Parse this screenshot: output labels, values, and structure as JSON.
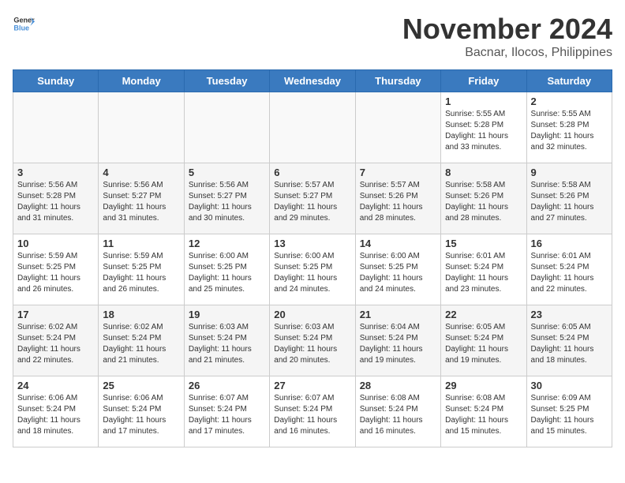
{
  "header": {
    "logo_general": "General",
    "logo_blue": "Blue",
    "month": "November 2024",
    "location": "Bacnar, Ilocos, Philippines"
  },
  "weekdays": [
    "Sunday",
    "Monday",
    "Tuesday",
    "Wednesday",
    "Thursday",
    "Friday",
    "Saturday"
  ],
  "weeks": [
    [
      {
        "day": "",
        "info": ""
      },
      {
        "day": "",
        "info": ""
      },
      {
        "day": "",
        "info": ""
      },
      {
        "day": "",
        "info": ""
      },
      {
        "day": "",
        "info": ""
      },
      {
        "day": "1",
        "info": "Sunrise: 5:55 AM\nSunset: 5:28 PM\nDaylight: 11 hours\nand 33 minutes."
      },
      {
        "day": "2",
        "info": "Sunrise: 5:55 AM\nSunset: 5:28 PM\nDaylight: 11 hours\nand 32 minutes."
      }
    ],
    [
      {
        "day": "3",
        "info": "Sunrise: 5:56 AM\nSunset: 5:28 PM\nDaylight: 11 hours\nand 31 minutes."
      },
      {
        "day": "4",
        "info": "Sunrise: 5:56 AM\nSunset: 5:27 PM\nDaylight: 11 hours\nand 31 minutes."
      },
      {
        "day": "5",
        "info": "Sunrise: 5:56 AM\nSunset: 5:27 PM\nDaylight: 11 hours\nand 30 minutes."
      },
      {
        "day": "6",
        "info": "Sunrise: 5:57 AM\nSunset: 5:27 PM\nDaylight: 11 hours\nand 29 minutes."
      },
      {
        "day": "7",
        "info": "Sunrise: 5:57 AM\nSunset: 5:26 PM\nDaylight: 11 hours\nand 28 minutes."
      },
      {
        "day": "8",
        "info": "Sunrise: 5:58 AM\nSunset: 5:26 PM\nDaylight: 11 hours\nand 28 minutes."
      },
      {
        "day": "9",
        "info": "Sunrise: 5:58 AM\nSunset: 5:26 PM\nDaylight: 11 hours\nand 27 minutes."
      }
    ],
    [
      {
        "day": "10",
        "info": "Sunrise: 5:59 AM\nSunset: 5:25 PM\nDaylight: 11 hours\nand 26 minutes."
      },
      {
        "day": "11",
        "info": "Sunrise: 5:59 AM\nSunset: 5:25 PM\nDaylight: 11 hours\nand 26 minutes."
      },
      {
        "day": "12",
        "info": "Sunrise: 6:00 AM\nSunset: 5:25 PM\nDaylight: 11 hours\nand 25 minutes."
      },
      {
        "day": "13",
        "info": "Sunrise: 6:00 AM\nSunset: 5:25 PM\nDaylight: 11 hours\nand 24 minutes."
      },
      {
        "day": "14",
        "info": "Sunrise: 6:00 AM\nSunset: 5:25 PM\nDaylight: 11 hours\nand 24 minutes."
      },
      {
        "day": "15",
        "info": "Sunrise: 6:01 AM\nSunset: 5:24 PM\nDaylight: 11 hours\nand 23 minutes."
      },
      {
        "day": "16",
        "info": "Sunrise: 6:01 AM\nSunset: 5:24 PM\nDaylight: 11 hours\nand 22 minutes."
      }
    ],
    [
      {
        "day": "17",
        "info": "Sunrise: 6:02 AM\nSunset: 5:24 PM\nDaylight: 11 hours\nand 22 minutes."
      },
      {
        "day": "18",
        "info": "Sunrise: 6:02 AM\nSunset: 5:24 PM\nDaylight: 11 hours\nand 21 minutes."
      },
      {
        "day": "19",
        "info": "Sunrise: 6:03 AM\nSunset: 5:24 PM\nDaylight: 11 hours\nand 21 minutes."
      },
      {
        "day": "20",
        "info": "Sunrise: 6:03 AM\nSunset: 5:24 PM\nDaylight: 11 hours\nand 20 minutes."
      },
      {
        "day": "21",
        "info": "Sunrise: 6:04 AM\nSunset: 5:24 PM\nDaylight: 11 hours\nand 19 minutes."
      },
      {
        "day": "22",
        "info": "Sunrise: 6:05 AM\nSunset: 5:24 PM\nDaylight: 11 hours\nand 19 minutes."
      },
      {
        "day": "23",
        "info": "Sunrise: 6:05 AM\nSunset: 5:24 PM\nDaylight: 11 hours\nand 18 minutes."
      }
    ],
    [
      {
        "day": "24",
        "info": "Sunrise: 6:06 AM\nSunset: 5:24 PM\nDaylight: 11 hours\nand 18 minutes."
      },
      {
        "day": "25",
        "info": "Sunrise: 6:06 AM\nSunset: 5:24 PM\nDaylight: 11 hours\nand 17 minutes."
      },
      {
        "day": "26",
        "info": "Sunrise: 6:07 AM\nSunset: 5:24 PM\nDaylight: 11 hours\nand 17 minutes."
      },
      {
        "day": "27",
        "info": "Sunrise: 6:07 AM\nSunset: 5:24 PM\nDaylight: 11 hours\nand 16 minutes."
      },
      {
        "day": "28",
        "info": "Sunrise: 6:08 AM\nSunset: 5:24 PM\nDaylight: 11 hours\nand 16 minutes."
      },
      {
        "day": "29",
        "info": "Sunrise: 6:08 AM\nSunset: 5:24 PM\nDaylight: 11 hours\nand 15 minutes."
      },
      {
        "day": "30",
        "info": "Sunrise: 6:09 AM\nSunset: 5:25 PM\nDaylight: 11 hours\nand 15 minutes."
      }
    ]
  ]
}
